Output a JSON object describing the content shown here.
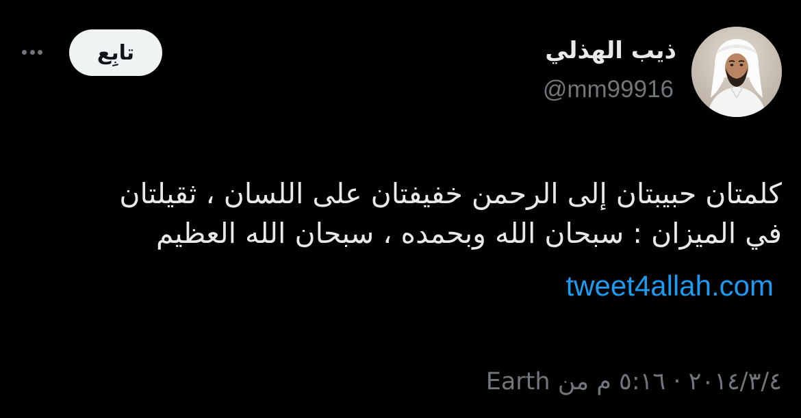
{
  "author": {
    "display_name": "ذيب الهذلي",
    "handle": "@mm99916",
    "avatar_icon": "profile-photo"
  },
  "actions": {
    "follow_label": "تابِع",
    "more_icon": "more-horizontal-icon"
  },
  "tweet": {
    "lines": [
      "كلمتان حبيبتان إلى الرحمن خفيفتان على اللسان ، ثقيلتان",
      "في الميزان : سبحان الله وبحمده ، سبحان الله العظيم"
    ],
    "link": "tweet4allah.com",
    "meta": "٢٠١٤/٣/٤ · ٥:١٦ م من Earth"
  },
  "colors": {
    "background": "#000000",
    "primary_text": "#e7e9ea",
    "secondary_text": "#71767b",
    "link": "#1d9bf0",
    "follow_button_bg": "#eff3f4"
  }
}
